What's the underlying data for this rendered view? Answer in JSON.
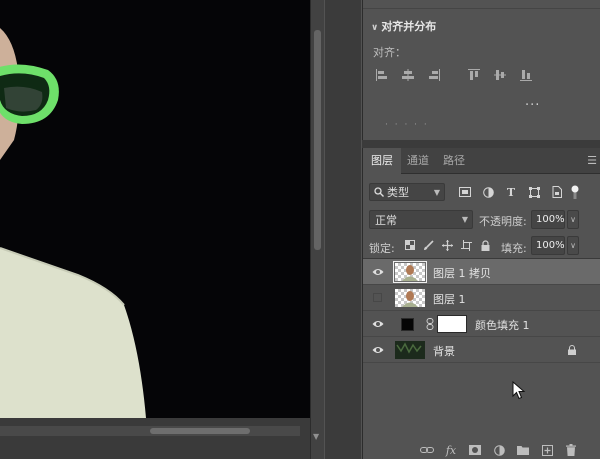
{
  "align_panel": {
    "title": "对齐并分布",
    "align_label": "对齐：",
    "more_label": "...",
    "next_section_label": "· · · · ·"
  },
  "layers_panel": {
    "tabs": [
      {
        "label": "图层",
        "active": true
      },
      {
        "label": "通道",
        "active": false
      },
      {
        "label": "路径",
        "active": false
      }
    ],
    "filter_type": "类型",
    "blend_mode": "正常",
    "opacity_label": "不透明度:",
    "opacity_value": "100%",
    "lock_label": "锁定:",
    "fill_label": "填充:",
    "fill_value": "100%",
    "layers": [
      {
        "name": "图层 1 拷贝",
        "visible": true,
        "selected": true,
        "thumb": "transparent-person"
      },
      {
        "name": "图层 1",
        "visible": false,
        "selected": false,
        "thumb": "transparent-person"
      },
      {
        "name": "颜色填充 1",
        "visible": true,
        "selected": false,
        "thumb": "fill-white"
      },
      {
        "name": "背景",
        "visible": true,
        "selected": false,
        "thumb": "dark-photo",
        "locked": true
      }
    ],
    "footer_icons": [
      "link-icon",
      "fx-icon",
      "mask-icon",
      "adjustment-icon",
      "folder-icon",
      "new-layer-icon",
      "trash-icon"
    ]
  },
  "colors": {
    "canvas_bg": "#050507",
    "panel_bg": "#535353",
    "selected_row": "#6a6a6a",
    "glasses_green": "#6ee06a",
    "jacket": "#dde1cc"
  }
}
